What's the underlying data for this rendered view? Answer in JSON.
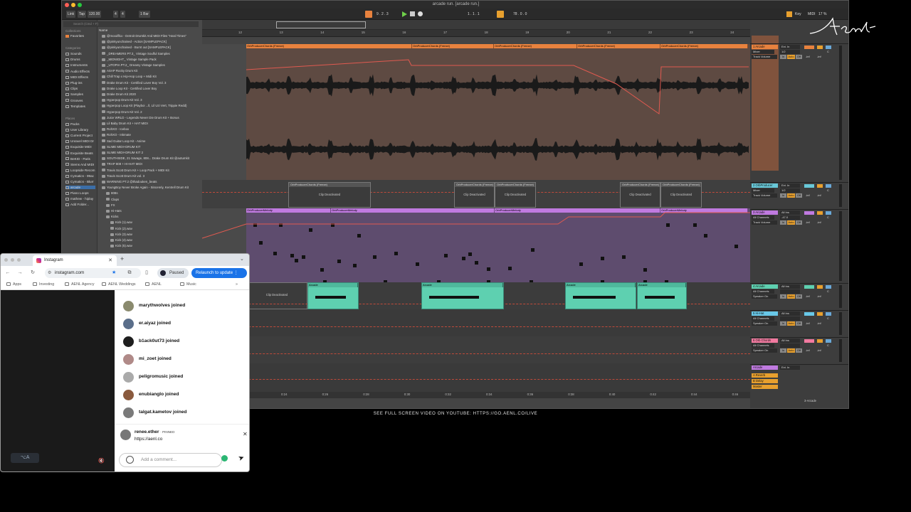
{
  "ableton": {
    "title": "arcade run.  [arcade run.]",
    "transport": {
      "link": "Link",
      "tap": "Tap",
      "tempo": "120.00",
      "sig_num": "4",
      "sig_den": "4",
      "quant": "1 Bar",
      "pos": "9 .  2 .  3",
      "loop_pos": "1 .  1 .  1",
      "loop_len": "78 .  0 .  0",
      "key": "Key",
      "midi": "MIDI",
      "cpu": "17 %"
    },
    "browser": {
      "search_placeholder": "Search (Cmd + F)",
      "collections_head": "Collections",
      "favorites": "Favorites",
      "categories_head": "Categories",
      "categories": [
        "Sounds",
        "Drums",
        "Instruments",
        "Audio Effects",
        "MIDI Effects",
        "Plug-ins",
        "Clips",
        "Samples",
        "Grooves",
        "Templates"
      ],
      "places_head": "Places",
      "places": [
        "Packs",
        "User Library",
        "Current Project",
        "Unravel MIDI Dr",
        "Exquisite MIDI",
        "Exquisite Beats",
        "BeKID - Paris",
        "Stems And MIDI",
        "Loopside Recom",
        "Cymatics - 99ac",
        "Cymatics - Blurr",
        "arcade",
        "Piano Loops",
        "mathew - hiplay",
        "Add Folder..."
      ],
      "name_head": "Name",
      "files": [
        "@moodfl1x - Detroit Drumkit And MIDI Files \"Hard Times\"",
        "@pinkyunchained - Action [SAMPLEPACK]",
        "@pinkyunchained - Burnt out [SAMPLEPACK]",
        "_DREAMERS PT.3_ Vintage Soulful Samples",
        "_MIDNIGHT_ Vintage Sample Pack",
        "_UTOPIA PT.2_ Dreamy Vintage Samples",
        "ASAP Rocky Drum Kit",
        "Chill Trap x Hip-Hop Loop + Midi Kit",
        "Drake Drum Kit - Certified Lover Boy Vol. 3",
        "Drake Loop Kit - Certified Lover Boy",
        "Drake Drum Kit 2020",
        "Hyperpop Drum Kit Vol. 3",
        "Hyperpop Loop Kit (Playboi ...ll, Lil Uzi Vert, Trippie Redd)",
        "Hyperpop Drum Kit Vol. 2",
        "Juice WRLD - Legends Never Die Drum Kit + Bonus",
        "Lil Baby Drum Kit + HAT MIDI",
        "RohXO - Icebox",
        "RohXO - Inkmate",
        "Sad Guitar Loop Kit - Anime",
        "SLIME MIDI+DRUM KIT",
        "SLIME MIDI+DRUM KIT 2",
        "SOUTHSIDE, 21 Savage, 808... Drake Drum Kit @aotumkit",
        "TRAP 808 + HI-HAT MIDI",
        "Travis Scott Drum Kit + Loop Pack + MIDI Kit",
        "Travis Scott Drum Kit vol. 3",
        "WARNING PT.2 @thadouken_beats",
        "YoungBoy Never Broke Again - Sincerely, Kentrell Drum Kit",
        "808s",
        "Claps",
        "FX",
        "Hi-Hats",
        "Kicks",
        "Kick (1).wav",
        "Kick (2).wav",
        "Kick (3).wav",
        "Kick (4).wav",
        "Kick (5).wav"
      ]
    },
    "ruler": [
      "12",
      "13",
      "14",
      "15",
      "16",
      "17",
      "18",
      "19",
      "20",
      "21",
      "22",
      "23",
      "24"
    ],
    "timecodes": [
      "0:24",
      "0:26",
      "0:28",
      "0:30",
      "0:32",
      "0:34",
      "0:36",
      "0:38",
      "0:40",
      "0:42",
      "0:44",
      "0:46"
    ],
    "clips": {
      "freeze": "OrbProducerChords (Freeze)",
      "chords": "OrbProducerChords (Freeze)",
      "deactivated": "Clip Deactivated",
      "melody": "OrbProducerMelody",
      "arcade": "Arcade"
    },
    "mixer": {
      "tracks": [
        {
          "name": "1 Arcade",
          "color": "#e8823e",
          "input": "Ext. In",
          "mon1": "Mixer",
          "mon2": "Track Volume",
          "ch": "1/2"
        },
        {
          "name": "2 OrbProducer",
          "color": "#68c8d8",
          "input": "Ext. In",
          "mon1": "Mixer",
          "mon2": "Track Volume",
          "ch": "1/2"
        },
        {
          "name": "3 Arcade",
          "color": "#c07ae0",
          "input": "All Ins",
          "mon1": "All Channels",
          "mon2": "Track Volume",
          "ch": "-47.0"
        },
        {
          "name": "4 Arcade",
          "color": "#5ed0b0",
          "input": "All Ins",
          "mon1": "All Channels",
          "mon2": "Speaker On",
          "ch": ""
        },
        {
          "name": "5 Hi-Hat",
          "color": "#68c8e8",
          "input": "All Ins",
          "mon1": "All Channels",
          "mon2": "Speaker On",
          "ch": ""
        },
        {
          "name": "6 Orb Chords",
          "color": "#f27aa0",
          "input": "All Ins",
          "mon1": "All Channels",
          "mon2": "Speaker On",
          "ch": ""
        },
        {
          "name": "Arcade",
          "color": "#c07ae0",
          "input": "Ext. In",
          "mon1": "Mixer",
          "mon2": "Master",
          "ch": ""
        }
      ],
      "returns": [
        "A Reverb",
        "B Delay"
      ],
      "master": "Master",
      "in": "In",
      "auto": "Auto",
      "off": "Off",
      "inf": "-inf",
      "c": "C",
      "footer": "3-Arcade"
    }
  },
  "chrome": {
    "tab_title": "Instagram",
    "url": "instagram.com",
    "paused": "Paused",
    "relaunch": "Relaunch to update",
    "bookmarks": [
      "Apps",
      "Investing",
      "AENL Agency",
      "AENL Weddings",
      "AENL",
      "Music"
    ]
  },
  "instagram": {
    "joined": [
      {
        "user": "marythwolves joined",
        "color": "#8a8a6e"
      },
      {
        "user": "er.aiyaz joined",
        "color": "#5a6e8a"
      },
      {
        "user": "b1ack0ut73 joined",
        "color": "#1e1e1e"
      },
      {
        "user": "mi_zoet joined",
        "color": "#b08a88"
      },
      {
        "user": "peligromusic joined",
        "color": "#aaaaaa"
      },
      {
        "user": "enubianglo joined",
        "color": "#8a5a3e"
      },
      {
        "user": "talgat.kametov joined",
        "color": "#7a7a7a"
      }
    ],
    "pinned_user": "renee.ether",
    "pinned_tag": "· PINNED",
    "pinned_text": "https://aenl.co",
    "comment_placeholder": "Add a comment..."
  },
  "caption": "SEE FULL SCREEN VIDEO ON YOUTUBE: HTTPS://GO.AENL.CO/LIVE"
}
